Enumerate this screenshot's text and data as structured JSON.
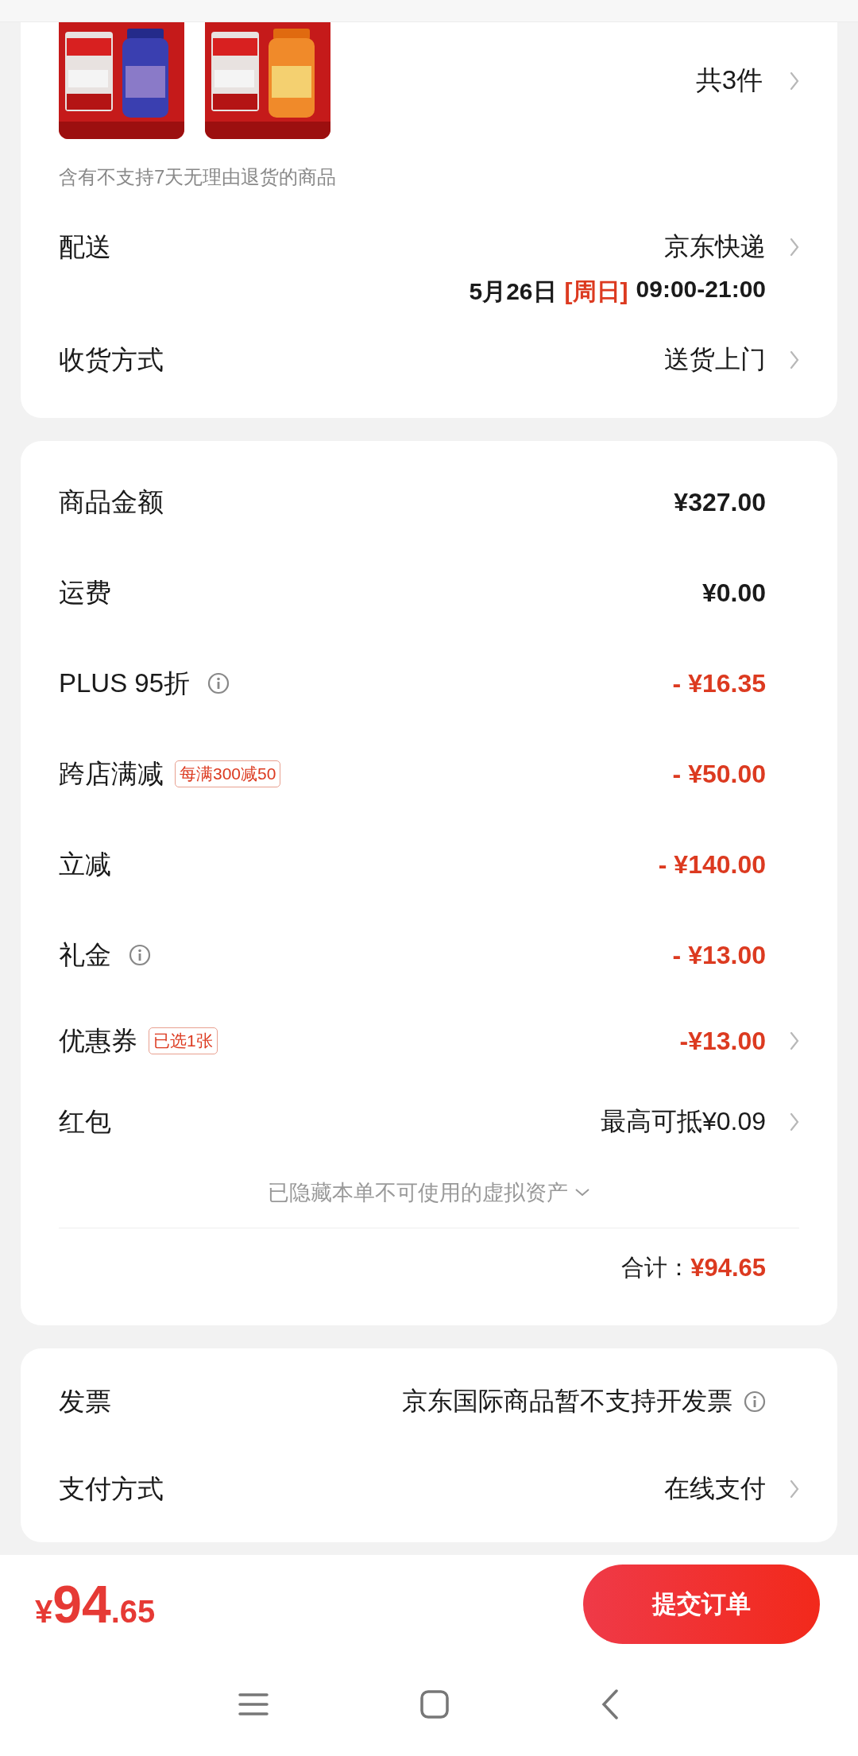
{
  "items_card": {
    "count": "共3件",
    "count_arrow": true,
    "notice": "含有不支持7天无理由退货的商品",
    "delivery": {
      "label": "配送",
      "value": "京东快递",
      "arrow": true,
      "date": "5月26日",
      "weekday": "[周日]",
      "time": "09:00-21:00"
    },
    "receive": {
      "label": "收货方式",
      "value": "送货上门",
      "arrow": true
    }
  },
  "price_card": {
    "rows": [
      {
        "label": "商品金额",
        "info": false,
        "value": "¥327.00",
        "discount": false,
        "arrow": false
      },
      {
        "label": "运费",
        "info": false,
        "value": "¥0.00",
        "discount": false,
        "arrow": false
      },
      {
        "label": "PLUS 95折",
        "info": true,
        "value": "- ¥16.35",
        "discount": true,
        "arrow": false
      },
      {
        "label": "跨店满减",
        "info": false,
        "tag": "每满300减50",
        "value": "- ¥50.00",
        "discount": true,
        "arrow": false
      },
      {
        "label": "立减",
        "info": false,
        "value": "- ¥140.00",
        "discount": true,
        "arrow": false
      },
      {
        "label": "礼金",
        "info": true,
        "value": "- ¥13.00",
        "discount": true,
        "arrow": false
      },
      {
        "label": "优惠券",
        "info": false,
        "tag": "已选1张",
        "value": "-¥13.00",
        "discount": true,
        "arrow": true
      },
      {
        "label": "红包",
        "info": false,
        "value": "最高可抵¥0.09",
        "discount": false,
        "arrow": true
      }
    ],
    "hidden_assets": {
      "text": "已隐藏本单不可使用的虚拟资产",
      "expanded": false
    },
    "total": {
      "label": "合计：",
      "value": "¥94.65"
    }
  },
  "other_card": {
    "rows": [
      {
        "label": "发票",
        "value": "京东国际商品暂不支持开发票",
        "info": true,
        "arrow": false
      },
      {
        "label": "支付方式",
        "value": "在线支付",
        "info": false,
        "arrow": true
      }
    ]
  },
  "footer": {
    "currency": "¥",
    "integer": "94",
    "decimal": ".65",
    "button": "提交订单"
  }
}
